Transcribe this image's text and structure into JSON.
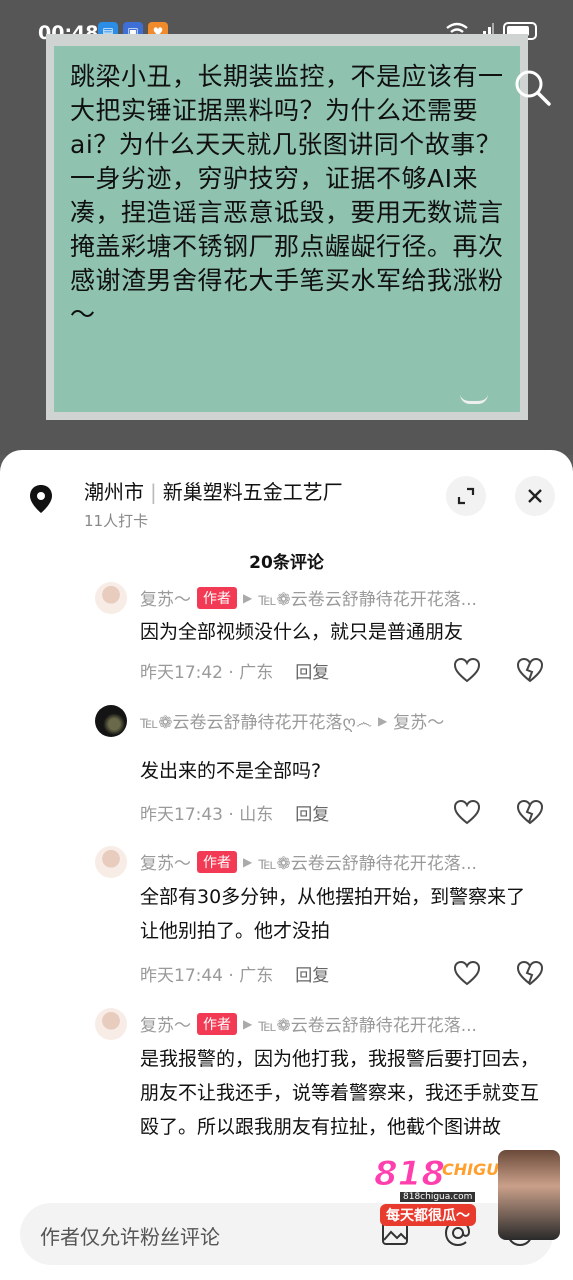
{
  "status": {
    "time": "00:48"
  },
  "video": {
    "board_text": "跳梁小丑，长期装监控，不是应该有一大把实锤证据黑料吗？为什么还需要ai？为什么天天就几张图讲同个故事？\n一身劣迹，穷驴技穷，证据不够AI来凑，捏造谣言恶意诋毁，要用无数谎言掩盖彩塘不锈钢厂那点龌龊行径。再次感谢渣男舍得花大手笔买水军给我涨粉～"
  },
  "location": {
    "city": "潮州市",
    "place": "新巢塑料五金工艺厂",
    "checkins": "11人打卡"
  },
  "comment_count": "20条评论",
  "comments": [
    {
      "name": "复苏～",
      "tag": "作者",
      "reply_to": "℡❁云卷云舒静待花开花落...",
      "text": "因为全部视频没什么，就只是普通朋友",
      "time": "昨天17:42 · 广东",
      "reply": "回复"
    },
    {
      "name": "℡❁云卷云舒静待花开花落ღ෴",
      "reply_to": "复苏～",
      "text": "发出来的不是全部吗?",
      "time": "昨天17:43 · 山东",
      "reply": "回复"
    },
    {
      "name": "复苏～",
      "tag": "作者",
      "reply_to": "℡❁云卷云舒静待花开花落...",
      "text": "全部有30多分钟，从他摆拍开始，到警察来了让他别拍了。他才没拍",
      "time": "昨天17:44 · 广东",
      "reply": "回复"
    },
    {
      "name": "复苏～",
      "tag": "作者",
      "reply_to": "℡❁云卷云舒静待花开花落...",
      "text": "是我报警的，因为他打我，我报警后要打回去，朋友不让我还手，说等着警察来，我还手就变互殴了。所以跟我朋友有拉扯，他截个图讲故"
    }
  ],
  "input": {
    "placeholder": "作者仅允许粉丝评论"
  },
  "watermark": {
    "number": "818",
    "brand": "CHIGUA",
    "url": "818chigua.com",
    "slogan": "每天都很瓜～"
  }
}
